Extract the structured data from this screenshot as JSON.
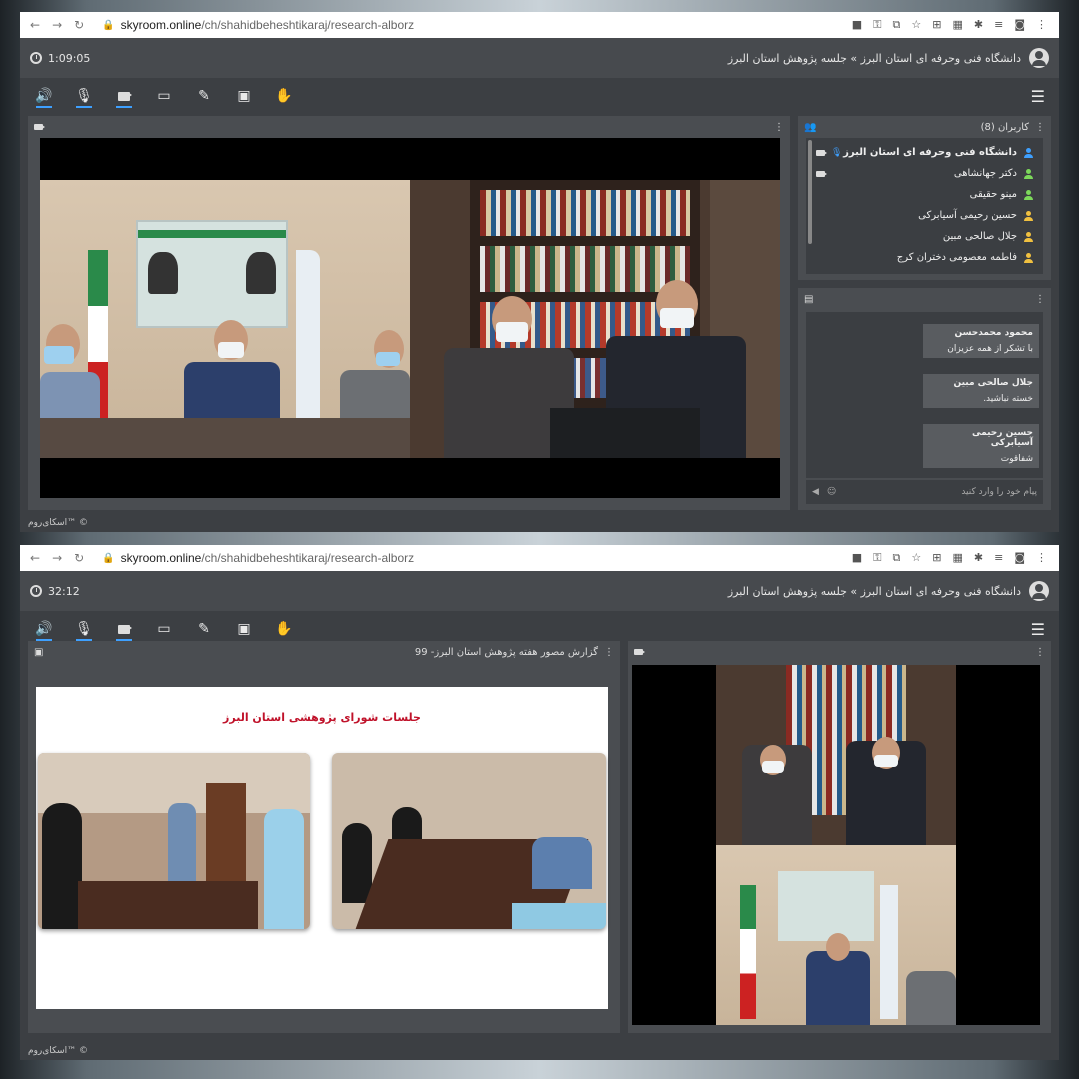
{
  "browser": {
    "url_host": "skyroom.online",
    "url_path": "/ch/shahidbeheshtikaraj/research-alborz"
  },
  "top": {
    "timer": "1:09:05",
    "room_title": "دانشگاه فنی وحرفه ای استان البرز » جلسه پژوهش استان البرز",
    "users_header": "کاربران (8)",
    "users": [
      {
        "name": "دانشگاه فنی وحرفه ای استان البرز",
        "color": "#3ea0ff",
        "bold": true,
        "mic": true,
        "cam": true
      },
      {
        "name": "دکتر جهانشاهی",
        "color": "#7cd85a",
        "cam": true
      },
      {
        "name": "مینو حقیقی",
        "color": "#7cd85a"
      },
      {
        "name": "حسین رحیمی آسیابرکی",
        "color": "#f0c040"
      },
      {
        "name": "جلال صالحی مبین",
        "color": "#f0c040"
      },
      {
        "name": "فاطمه معصومی دختران کرج",
        "color": "#f0c040"
      }
    ],
    "chat": [
      {
        "name": "محمود محمدحسن",
        "text": "با تشکر از همه عزیزان"
      },
      {
        "name": "جلال صالحی مبین",
        "text": "خسته نباشید."
      },
      {
        "name": "حسین رحیمی آسیابرکی",
        "text": "شفاقوت"
      }
    ],
    "chat_placeholder": "پیام خود را وارد کنید",
    "footer": "اسکای‌روم™ ©"
  },
  "bottom": {
    "timer": "32:12",
    "room_title": "دانشگاه فنی وحرفه ای استان البرز » جلسه پژوهش استان البرز",
    "slide_header": "گزارش مصور هفته پژوهش استان البرز- 99",
    "slide_title": "جلسات شورای پژوهشی استان البرز",
    "footer": "اسکای‌روم™ ©"
  },
  "icons": {
    "toolbar": [
      "speaker-icon",
      "mic-icon",
      "camera-icon",
      "screen-share-icon",
      "brush-icon",
      "play-icon",
      "hand-icon"
    ],
    "menu": "hamburger-icon"
  },
  "colors": {
    "accent": "#3ea0ff",
    "slide_title": "#c0122a"
  }
}
